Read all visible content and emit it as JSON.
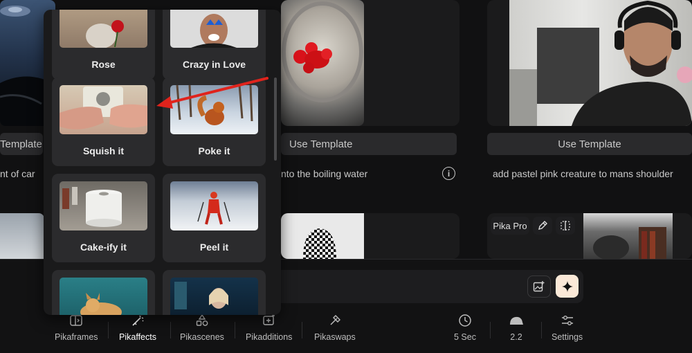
{
  "gallery": {
    "cards": [
      {
        "use_template": "Template",
        "caption": "nt of car"
      },
      {
        "use_template": "Use Template",
        "caption": "nto the boiling water"
      },
      {
        "use_template": "Use Template",
        "caption": "add pastel pink creature to mans shoulder"
      }
    ],
    "pika_pro_label": "Pika Pro",
    "icons": [
      "info-icon",
      "edit-icon",
      "compare-icon"
    ]
  },
  "effects_popup": {
    "items": [
      {
        "label": "Rose"
      },
      {
        "label": "Crazy in Love"
      },
      {
        "label": "Squish it"
      },
      {
        "label": "Poke it"
      },
      {
        "label": "Cake-ify it"
      },
      {
        "label": "Peel it"
      },
      {
        "label": ""
      },
      {
        "label": ""
      }
    ],
    "highlighted_item": "Squish it"
  },
  "prompt_bar": {
    "image_upload_icon": "image-plus-icon",
    "generate_icon": "sparkle-icon"
  },
  "toolbar": {
    "tools": [
      {
        "label": "Pikaframes",
        "icon": "frames-icon"
      },
      {
        "label": "Pikaffects",
        "icon": "magic-wand-icon",
        "active": true
      },
      {
        "label": "Pikascenes",
        "icon": "shapes-icon"
      },
      {
        "label": "Pikadditions",
        "icon": "add-frame-icon"
      },
      {
        "label": "Pikaswaps",
        "icon": "swap-wand-icon"
      }
    ],
    "settings": [
      {
        "label": "5 Sec",
        "icon": "clock-icon"
      },
      {
        "label": "2.2",
        "icon": "model-icon"
      },
      {
        "label": "Settings",
        "icon": "sliders-icon"
      }
    ]
  },
  "colors": {
    "background": "#111112",
    "popup": "#1a1a1b",
    "effect_card": "#2b2b2d",
    "generate_button": "#fbe9d8",
    "annotation_arrow": "#e0231c"
  }
}
